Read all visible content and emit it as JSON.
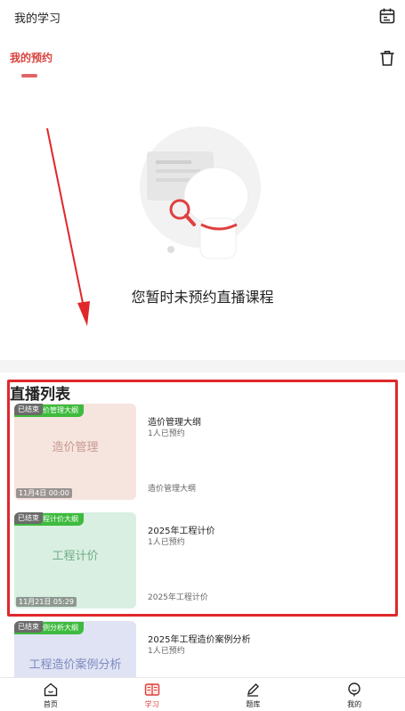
{
  "header": {
    "title": "我的学习",
    "calendar_icon": "calendar-icon"
  },
  "tabs": {
    "active_label": "我的预约",
    "trash_icon": "trash-icon"
  },
  "empty_state": {
    "message": "您暂时未预约直播课程"
  },
  "live_list": {
    "title": "直播列表",
    "items": [
      {
        "thumb_text": "造价管理",
        "tag": "造价管理大纲",
        "badge": "已结束",
        "time": "11月4日 00:00",
        "title": "造价管理大纲",
        "booked": "1人已预约",
        "footer": "造价管理大纲",
        "thumb_bg": "#f6e4df",
        "thumb_color": "#c79a8f"
      },
      {
        "thumb_text": "工程计价",
        "tag": "工程计价大纲",
        "badge": "已结束",
        "time": "11月21日 05:29",
        "title": "2025年工程计价",
        "booked": "1人已预约",
        "footer": "2025年工程计价",
        "thumb_bg": "#d9efe1",
        "thumb_color": "#6fae88"
      },
      {
        "thumb_text": "工程造价案例分析",
        "tag": "案例分析大纲",
        "badge": "已结束",
        "time": "",
        "title": "2025年工程造价案例分析",
        "booked": "1人已预约",
        "footer": "",
        "thumb_bg": "#dfe3f3",
        "thumb_color": "#7e89c0"
      }
    ]
  },
  "bottom_nav": [
    {
      "label": "首页",
      "icon": "home-icon",
      "active": false
    },
    {
      "label": "学习",
      "icon": "book-icon",
      "active": true
    },
    {
      "label": "题库",
      "icon": "pencil-icon",
      "active": false
    },
    {
      "label": "我的",
      "icon": "user-icon",
      "active": false
    }
  ],
  "colors": {
    "accent": "#d9423e",
    "annotation_red": "#e0272a",
    "tag_green": "#3ebb3e"
  }
}
